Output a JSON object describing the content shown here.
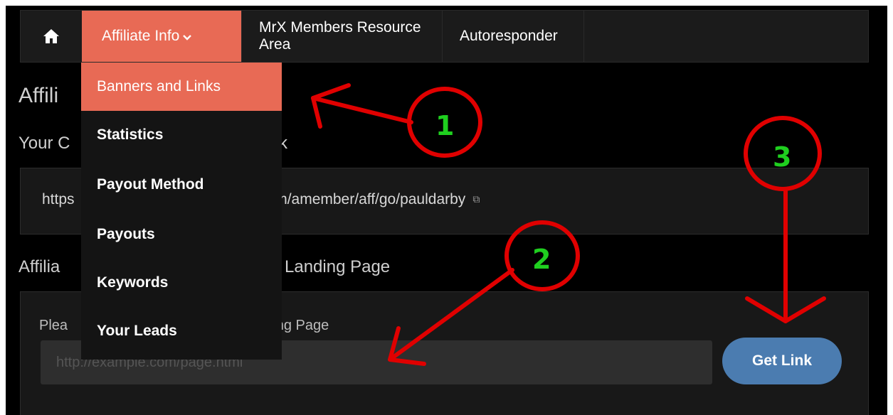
{
  "nav": {
    "home_icon": "home-icon",
    "affiliate_label": "Affiliate Info",
    "affiliate_chevron": "⌄",
    "mrx_label": "MrX Members Resource Area",
    "autoresponder_label": "Autoresponder"
  },
  "dropdown": {
    "items": [
      {
        "label": "Banners and Links"
      },
      {
        "label": "Statistics"
      },
      {
        "label": "Payout Method"
      },
      {
        "label": "Payouts"
      },
      {
        "label": "Keywords"
      },
      {
        "label": "Your Leads"
      }
    ]
  },
  "page": {
    "heading_partial": "Affili",
    "link_heading_partial_left": "Your C",
    "link_heading_partial_right": "k",
    "link_text_left": "https",
    "link_text_right": "om/amember/aff/go/pauldarby",
    "landing_heading_left": "Affilia",
    "landing_heading_right": "Landing Page",
    "landing_label_left": "Plea",
    "landing_label_right": "nding Page",
    "landing_placeholder": "http://example.com/page.html",
    "get_link_label": "Get Link"
  },
  "annotations": {
    "labels": [
      "1",
      "2",
      "3"
    ],
    "color_circle": "#e00000",
    "color_number": "#1fcf1f"
  },
  "colors": {
    "accent": "#e86a55",
    "button": "#4b7cb0",
    "background": "#000000"
  }
}
